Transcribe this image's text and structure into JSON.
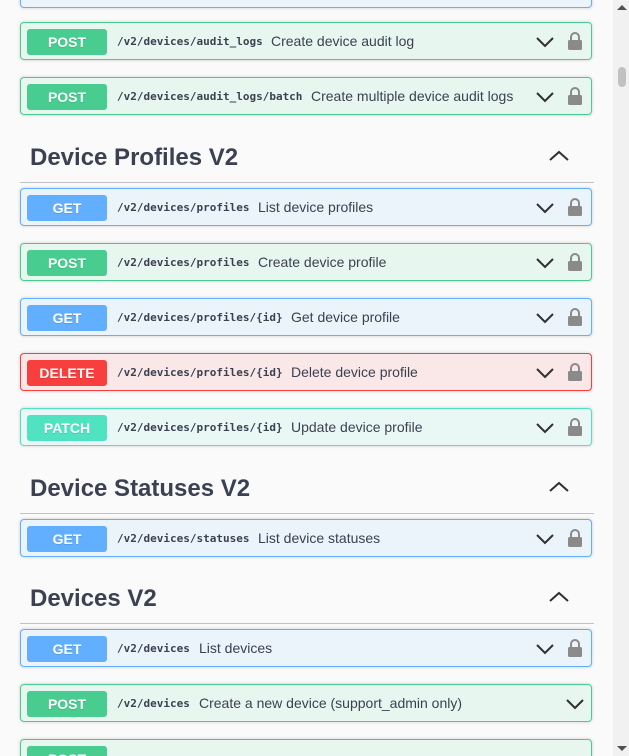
{
  "sections": {
    "profiles_title": "Device Profiles V2",
    "statuses_title": "Device Statuses V2",
    "devices_title": "Devices V2"
  },
  "operations": [
    {
      "method": "POST",
      "path": "/v2/devices/audit_logs",
      "summary": "Create device audit log"
    },
    {
      "method": "POST",
      "path": "/v2/devices/audit_logs/batch",
      "summary": "Create multiple device audit logs"
    },
    {
      "method": "GET",
      "path": "/v2/devices/profiles",
      "summary": "List device profiles"
    },
    {
      "method": "POST",
      "path": "/v2/devices/profiles",
      "summary": "Create device profile"
    },
    {
      "method": "GET",
      "path": "/v2/devices/profiles/{id}",
      "summary": "Get device profile"
    },
    {
      "method": "DELETE",
      "path": "/v2/devices/profiles/{id}",
      "summary": "Delete device profile"
    },
    {
      "method": "PATCH",
      "path": "/v2/devices/profiles/{id}",
      "summary": "Update device profile"
    },
    {
      "method": "GET",
      "path": "/v2/devices/statuses",
      "summary": "List device statuses"
    },
    {
      "method": "GET",
      "path": "/v2/devices",
      "summary": "List devices"
    },
    {
      "method": "POST",
      "path": "/v2/devices",
      "summary": "Create a new device (support_admin only)"
    },
    {
      "method": "POST",
      "path": "",
      "summary": ""
    }
  ],
  "colors": {
    "get": "#61affe",
    "post": "#49cc90",
    "delete": "#f93e3e",
    "patch": "#50e3c2",
    "text": "#3b4151"
  },
  "icons": {
    "expand": "chevron-down-icon",
    "collapse": "chevron-up-icon",
    "auth": "lock-icon"
  }
}
